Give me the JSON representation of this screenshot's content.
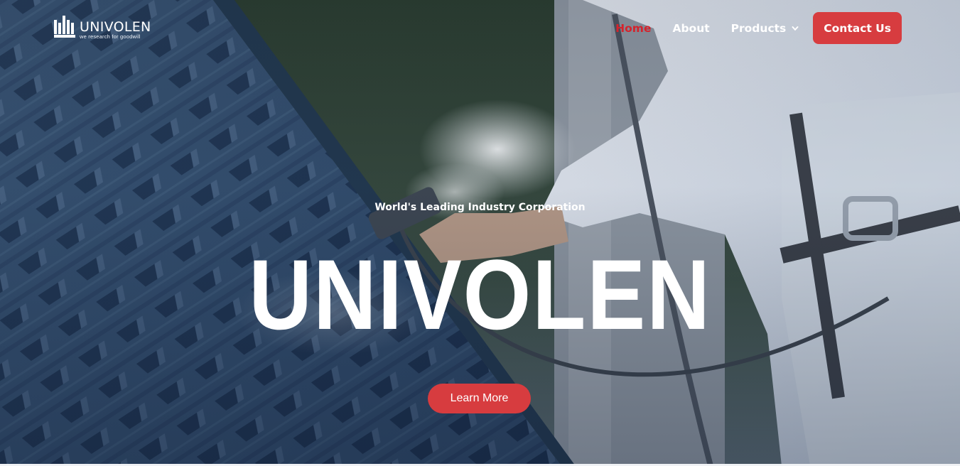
{
  "brand": {
    "name": "UNIVOLEN",
    "tagline": "we research for goodwill"
  },
  "nav": {
    "items": [
      {
        "label": "Home",
        "active": true
      },
      {
        "label": "About",
        "active": false
      },
      {
        "label": "Products",
        "active": false,
        "dropdown": true
      }
    ],
    "contact_label": "Contact Us"
  },
  "hero": {
    "eyebrow": "World's Leading Industry Corporation",
    "headline": "UNIVOLEN",
    "cta_label": "Learn More"
  },
  "colors": {
    "accent": "#d73c3f",
    "active_nav": "#d4232c",
    "text": "#ffffff"
  },
  "icons": {
    "logo": "univolen-logo-icon",
    "dropdown": "chevron-down-icon"
  }
}
